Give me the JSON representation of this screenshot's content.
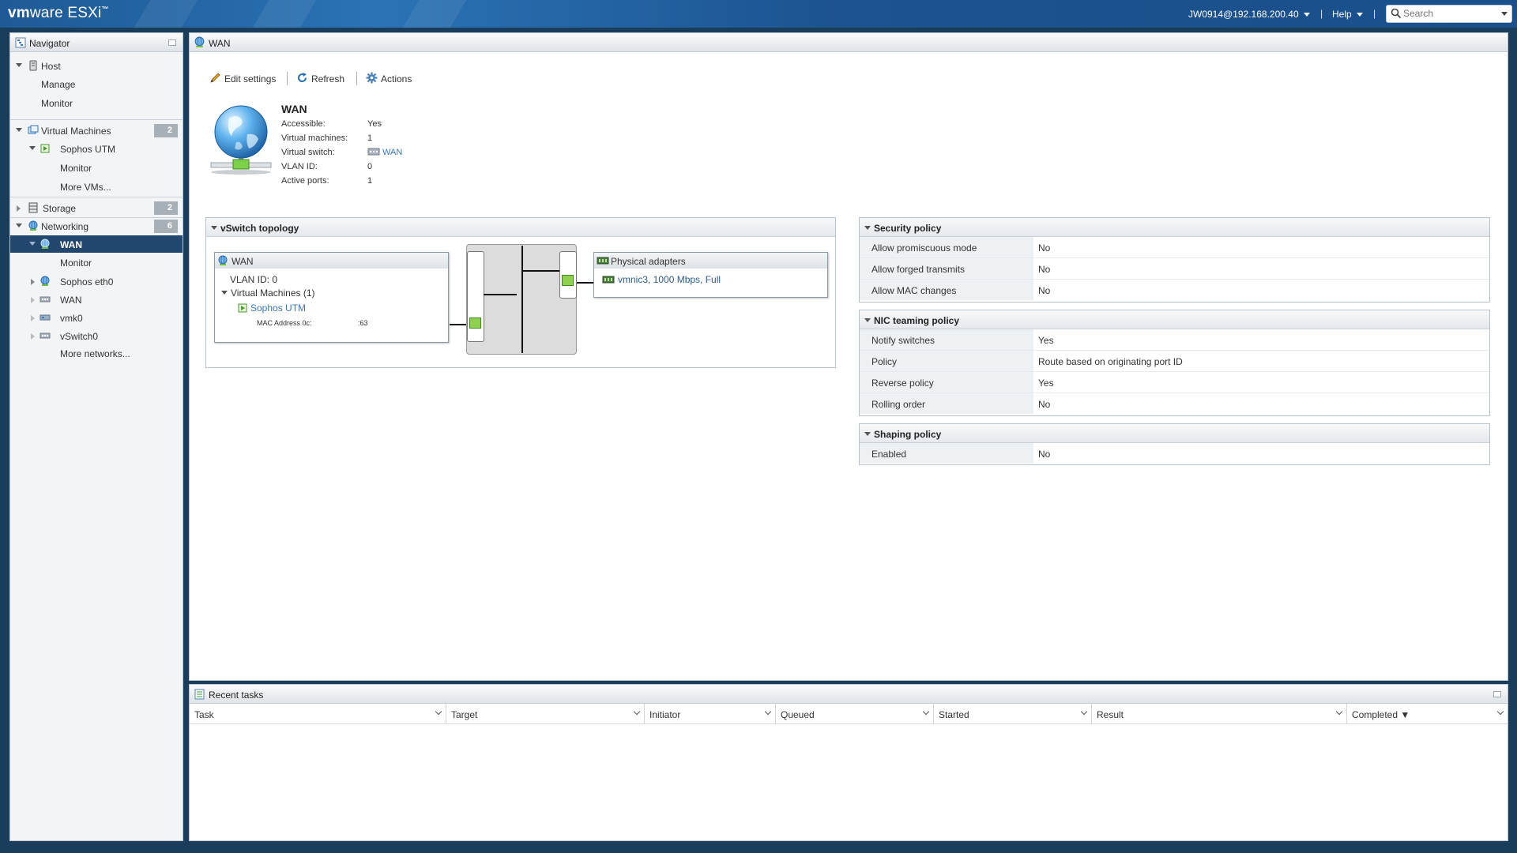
{
  "app": {
    "brand_vm": "vm",
    "brand_ware": "ware",
    "brand_product": "ESXi",
    "trademark": "™"
  },
  "topbar": {
    "user": "JW0914@192.168.200.40",
    "help": "Help",
    "search_placeholder": "Search"
  },
  "navigator": {
    "title": "Navigator",
    "items": [
      {
        "label": "Host"
      },
      {
        "label": "Manage"
      },
      {
        "label": "Monitor"
      },
      {
        "label": "Virtual Machines",
        "badge": "2"
      },
      {
        "label": "Sophos UTM"
      },
      {
        "label": "Monitor"
      },
      {
        "label": "More VMs..."
      },
      {
        "label": "Storage",
        "badge": "2"
      },
      {
        "label": "Networking",
        "badge": "6"
      },
      {
        "label": "WAN"
      },
      {
        "label": "Monitor"
      },
      {
        "label": "Sophos eth0"
      },
      {
        "label": "WAN"
      },
      {
        "label": "vmk0"
      },
      {
        "label": "vSwitch0"
      },
      {
        "label": "More networks..."
      }
    ]
  },
  "main": {
    "title": "WAN",
    "toolbar": {
      "edit": "Edit settings",
      "refresh": "Refresh",
      "actions": "Actions"
    },
    "info": {
      "name": "WAN",
      "rows": [
        {
          "k": "Accessible:",
          "v": "Yes"
        },
        {
          "k": "Virtual machines:",
          "v": "1"
        },
        {
          "k": "Virtual switch:",
          "v": "WAN"
        },
        {
          "k": "VLAN ID:",
          "v": "0"
        },
        {
          "k": "Active ports:",
          "v": "1"
        }
      ]
    },
    "topology": {
      "title": "vSwitch topology",
      "portgroup": {
        "name": "WAN",
        "vlan": "VLAN ID: 0",
        "vms": "Virtual Machines (1)",
        "vm": "Sophos UTM",
        "mac_label": "MAC Address 0c:",
        "mac_value": ":63"
      },
      "adapters": {
        "title": "Physical adapters",
        "nic": "vmnic3, 1000 Mbps, Full"
      }
    },
    "security": {
      "title": "Security policy",
      "rows": [
        {
          "k": "Allow promiscuous mode",
          "v": "No"
        },
        {
          "k": "Allow forged transmits",
          "v": "No"
        },
        {
          "k": "Allow MAC changes",
          "v": "No"
        }
      ]
    },
    "nic": {
      "title": "NIC teaming policy",
      "rows": [
        {
          "k": "Notify switches",
          "v": "Yes"
        },
        {
          "k": "Policy",
          "v": "Route based on originating port ID"
        },
        {
          "k": "Reverse policy",
          "v": "Yes"
        },
        {
          "k": "Rolling order",
          "v": "No"
        }
      ]
    },
    "shaping": {
      "title": "Shaping policy",
      "rows": [
        {
          "k": "Enabled",
          "v": "No"
        }
      ]
    }
  },
  "tasks": {
    "title": "Recent tasks",
    "columns": [
      "Task",
      "Target",
      "Initiator",
      "Queued",
      "Started",
      "Result",
      "Completed ▼"
    ]
  },
  "colors": {
    "accent": "#21476e",
    "link": "#3a77b8",
    "port_green": "#8fd14f"
  }
}
